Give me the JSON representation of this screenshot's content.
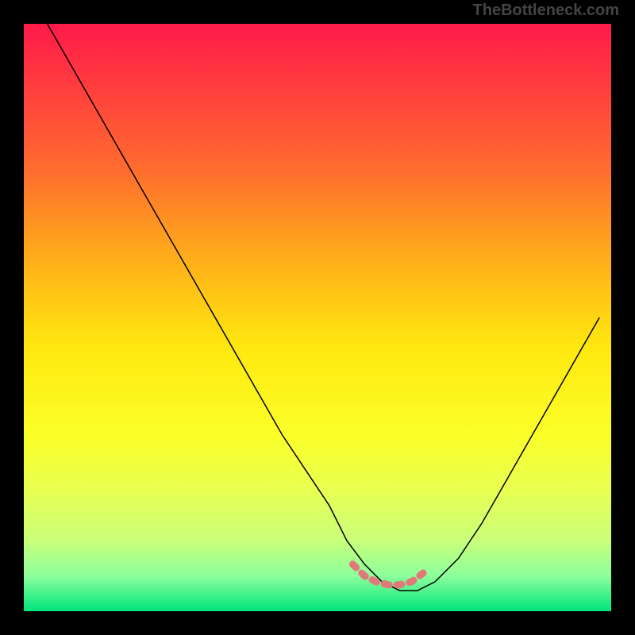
{
  "watermark": "TheBottleneck.com",
  "chart_data": {
    "type": "line",
    "title": "",
    "xlabel": "",
    "ylabel": "",
    "xlim": [
      0,
      100
    ],
    "ylim": [
      0,
      100
    ],
    "background_gradient": {
      "stops": [
        {
          "offset": 0.0,
          "color": "#ff1a4a"
        },
        {
          "offset": 0.1,
          "color": "#ff3b3f"
        },
        {
          "offset": 0.25,
          "color": "#ff6d2e"
        },
        {
          "offset": 0.4,
          "color": "#ffae1a"
        },
        {
          "offset": 0.55,
          "color": "#ffe80f"
        },
        {
          "offset": 0.7,
          "color": "#fbff28"
        },
        {
          "offset": 0.8,
          "color": "#e6ff55"
        },
        {
          "offset": 0.88,
          "color": "#c9ff7a"
        },
        {
          "offset": 0.94,
          "color": "#8cff9c"
        },
        {
          "offset": 1.0,
          "color": "#00e57a"
        }
      ]
    },
    "series": [
      {
        "name": "bottleneck-curve",
        "color": "#000000",
        "width": 1.5,
        "x": [
          4,
          8,
          12,
          16,
          20,
          24,
          28,
          32,
          36,
          40,
          44,
          48,
          52,
          55,
          58,
          61,
          64,
          67,
          70,
          74,
          78,
          82,
          86,
          90,
          94,
          98
        ],
        "y": [
          100,
          93,
          86,
          79,
          72,
          65,
          58,
          51,
          44,
          37,
          30,
          24,
          18,
          12,
          8,
          5,
          3.5,
          3.5,
          5,
          9,
          15,
          22,
          29,
          36,
          43,
          50
        ]
      }
    ],
    "highlight_segment": {
      "name": "optimal-zone",
      "color": "#e07a7a",
      "width": 9,
      "x": [
        56,
        58,
        60,
        62,
        64,
        66,
        68
      ],
      "y": [
        8,
        6,
        5,
        4.5,
        4.5,
        5,
        6.5
      ]
    }
  }
}
